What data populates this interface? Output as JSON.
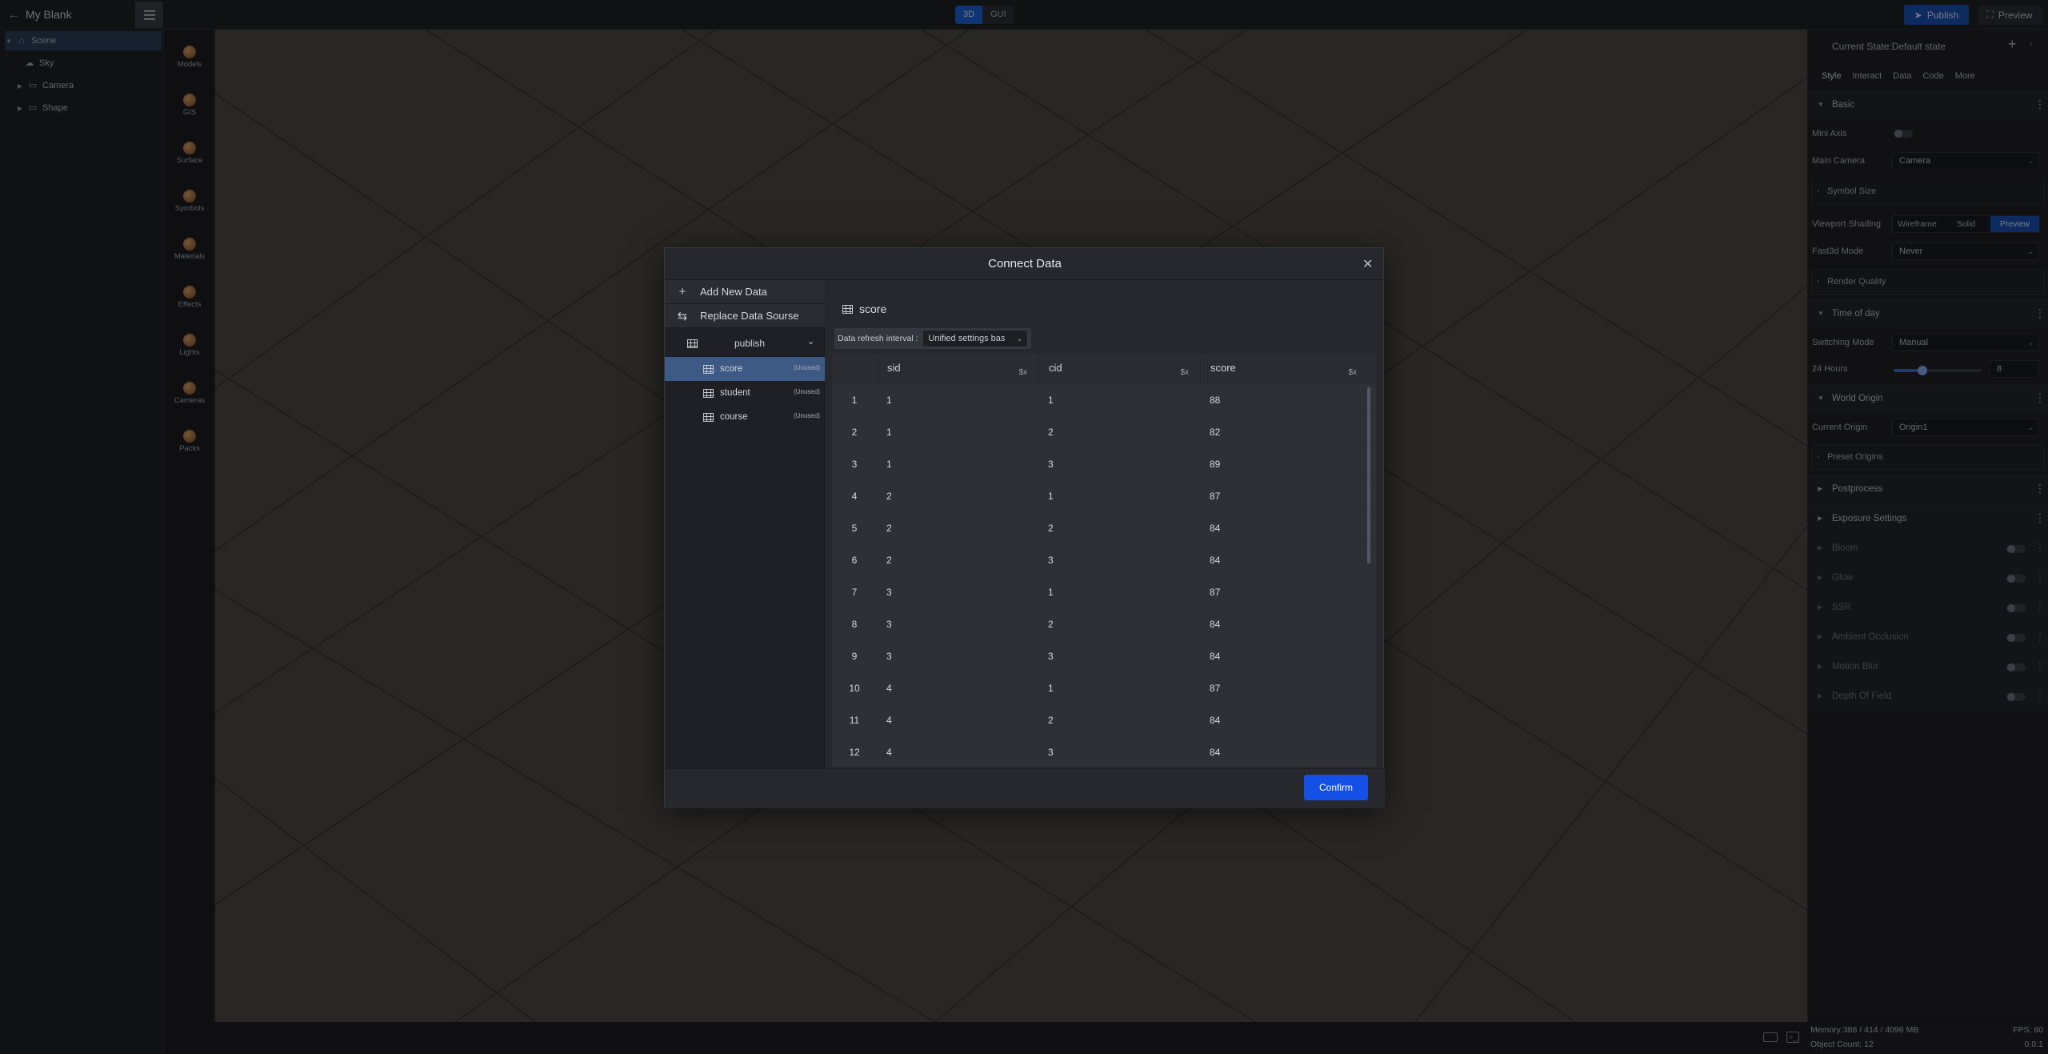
{
  "topbar": {
    "app_title": "My Blank",
    "mode_tabs": [
      "3D",
      "GUI"
    ],
    "publish_label": "Publish",
    "preview_label": "Preview"
  },
  "tree": {
    "items": [
      "Scene",
      "Sky",
      "Camera",
      "Shape"
    ]
  },
  "assets": {
    "items": [
      "Models",
      "GIS",
      "Surface",
      "Symbols",
      "Materials",
      "Effects",
      "Lights",
      "Cameras",
      "Packs"
    ]
  },
  "panel": {
    "state_title": "Current State:Default state",
    "tabs": [
      "Style",
      "Interact",
      "Data",
      "Code",
      "More"
    ],
    "basic": "Basic",
    "mini_axis": "Mini Axis",
    "main_camera_label": "Main Camera",
    "main_camera_value": "Camera",
    "symbol_size": "Symbol Size",
    "viewport_shading_label": "Viewport Shading",
    "shading_options": [
      "Wireframe",
      "Solid",
      "Preview"
    ],
    "fast3d_label": "Fast3d Mode",
    "fast3d_value": "Never",
    "render_quality": "Render Quality",
    "time_of_day": "Time of day",
    "switching_mode_label": "Switching Mode",
    "switching_mode_value": "Manual",
    "hours_label": "24 Hours",
    "hours_value": "8",
    "hours_fraction": 0.33,
    "world_origin": "World Origin",
    "current_origin_label": "Current Origin",
    "current_origin_value": "Origin1",
    "preset_origins": "Preset Origins",
    "postprocess": "Postprocess",
    "exposure": "Exposure Settings",
    "effects": [
      "Bloom",
      "Glow",
      "SSR",
      "Ambient Occlusion",
      "Motion Blur",
      "Depth Of Field"
    ]
  },
  "status": {
    "memory": "Memory:386 / 414 / 4096 MB",
    "fps": "FPS: 60",
    "object_count": "Object Count: 12",
    "version": "0.0.1"
  },
  "dialog": {
    "title": "Connect Data",
    "add_new": "Add New Data",
    "replace_source": "Replace Data Sourse",
    "source_name": "publish",
    "tables": [
      {
        "name": "score",
        "badge": "(Unused)"
      },
      {
        "name": "student",
        "badge": "(Unused)"
      },
      {
        "name": "course",
        "badge": "(Unused)"
      }
    ],
    "main_title": "score",
    "refresh_label": "Data refresh interval :",
    "refresh_value": "Unified settings bas",
    "columns": [
      "sid",
      "cid",
      "score"
    ],
    "col_icon": "$x",
    "rows": [
      [
        "1",
        "1",
        "1",
        "88"
      ],
      [
        "2",
        "1",
        "2",
        "82"
      ],
      [
        "3",
        "1",
        "3",
        "89"
      ],
      [
        "4",
        "2",
        "1",
        "87"
      ],
      [
        "5",
        "2",
        "2",
        "84"
      ],
      [
        "6",
        "2",
        "3",
        "84"
      ],
      [
        "7",
        "3",
        "1",
        "87"
      ],
      [
        "8",
        "3",
        "2",
        "84"
      ],
      [
        "9",
        "3",
        "3",
        "84"
      ],
      [
        "10",
        "4",
        "1",
        "87"
      ],
      [
        "11",
        "4",
        "2",
        "84"
      ],
      [
        "12",
        "4",
        "3",
        "84"
      ]
    ],
    "confirm": "Confirm"
  }
}
